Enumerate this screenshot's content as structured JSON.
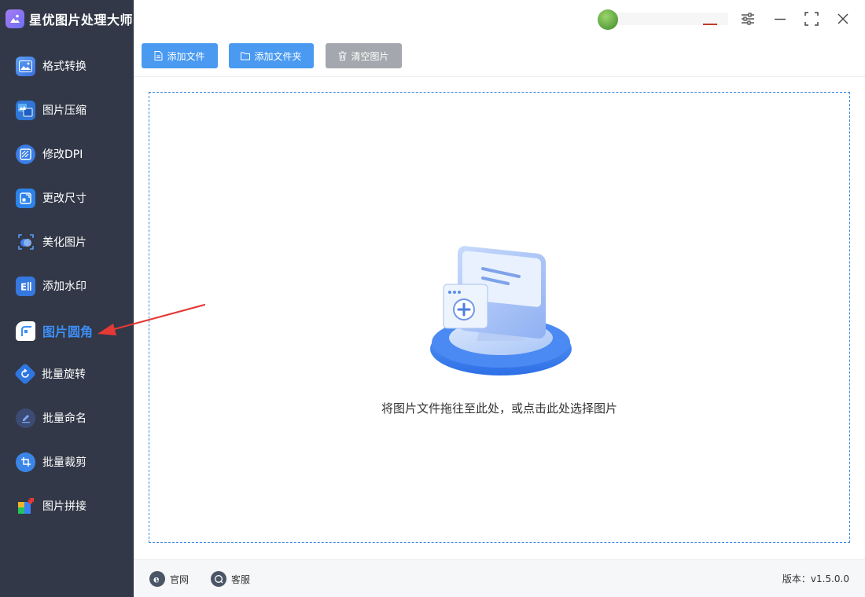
{
  "app": {
    "title": "星优图片处理大师"
  },
  "sidebar": {
    "items": [
      {
        "label": "格式转换",
        "icon": "image-format-icon",
        "active": false
      },
      {
        "label": "图片压缩",
        "icon": "image-compress-icon",
        "active": false
      },
      {
        "label": "修改DPI",
        "icon": "dpi-icon",
        "active": false
      },
      {
        "label": "更改尺寸",
        "icon": "resize-icon",
        "active": false
      },
      {
        "label": "美化图片",
        "icon": "beautify-icon",
        "active": false
      },
      {
        "label": "添加水印",
        "icon": "watermark-icon",
        "active": false
      },
      {
        "label": "图片圆角",
        "icon": "rounded-corner-icon",
        "active": true
      },
      {
        "label": "批量旋转",
        "icon": "rotate-icon",
        "active": false
      },
      {
        "label": "批量命名",
        "icon": "rename-icon",
        "active": false
      },
      {
        "label": "批量裁剪",
        "icon": "crop-icon",
        "active": false
      },
      {
        "label": "图片拼接",
        "icon": "puzzle-icon",
        "active": false
      }
    ]
  },
  "toolbar": {
    "add_file": "添加文件",
    "add_folder": "添加文件夹",
    "clear_images": "清空图片"
  },
  "dropzone": {
    "hint": "将图片文件拖往至此处，或点击此处选择图片"
  },
  "footer": {
    "website": "官网",
    "support": "客服",
    "version": "版本：v1.5.0.0"
  },
  "colors": {
    "sidebar_bg": "#323847",
    "accent": "#4a9af2",
    "active_label": "#3d8ef5",
    "annotation_arrow": "#e53935"
  }
}
